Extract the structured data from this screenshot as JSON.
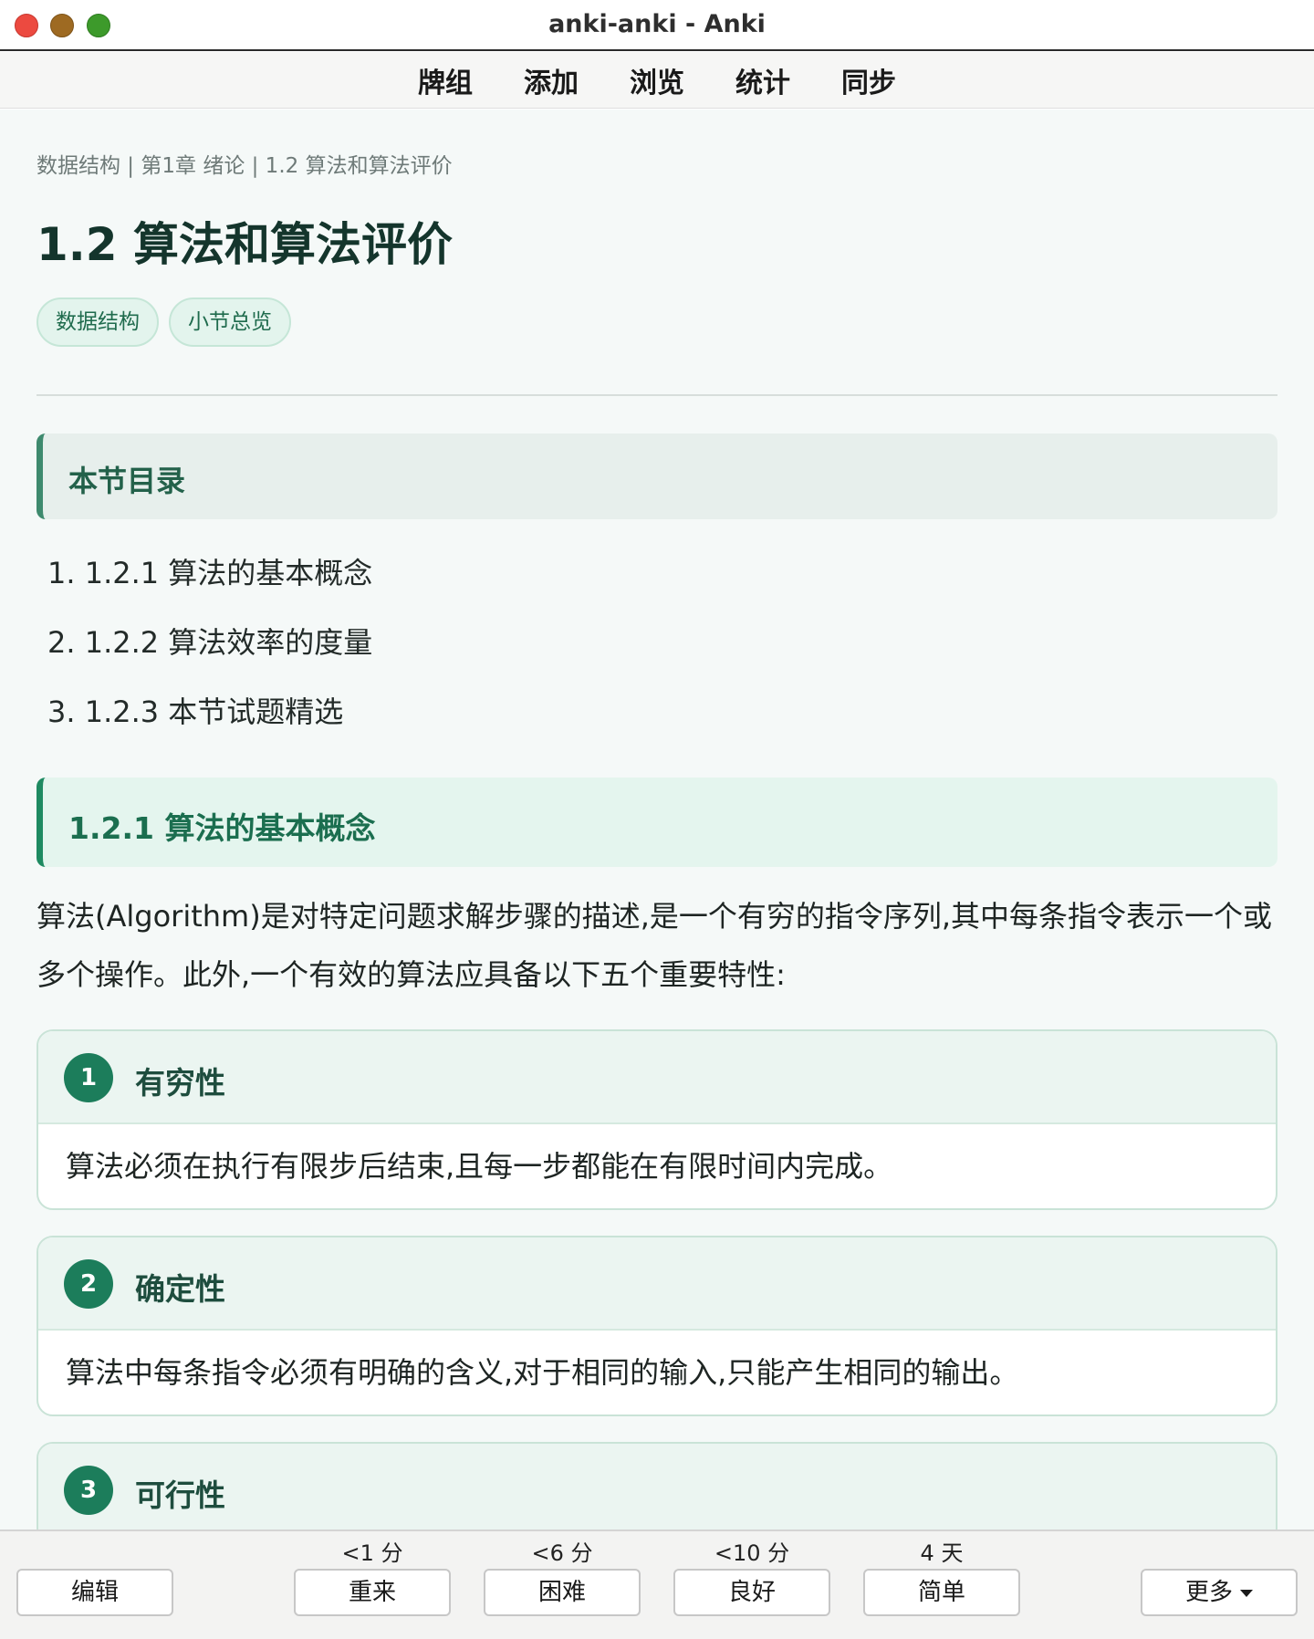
{
  "window": {
    "title": "anki-anki - Anki"
  },
  "toolbar": {
    "items": [
      "牌组",
      "添加",
      "浏览",
      "统计",
      "同步"
    ]
  },
  "card": {
    "breadcrumb": "数据结构 | 第1章 绪论 | 1.2 算法和算法评价",
    "title": "1.2 算法和算法评价",
    "tags": [
      "数据结构",
      "小节总览"
    ],
    "toc": {
      "heading": "本节目录",
      "items": [
        "1. 1.2.1 算法的基本概念",
        "2. 1.2.2 算法效率的度量",
        "3. 1.2.3 本节试题精选"
      ]
    },
    "section": {
      "heading": "1.2.1 算法的基本概念",
      "paragraph": "算法(Algorithm)是对特定问题求解步骤的描述,是一个有穷的指令序列,其中每条指令表示一个或多个操作。此外,一个有效的算法应具备以下五个重要特性:",
      "properties": [
        {
          "num": "1",
          "title": "有穷性",
          "body": "算法必须在执行有限步后结束,且每一步都能在有限时间内完成。"
        },
        {
          "num": "2",
          "title": "确定性",
          "body": "算法中每条指令必须有明确的含义,对于相同的输入,只能产生相同的输出。"
        },
        {
          "num": "3",
          "title": "可行性",
          "body": ""
        }
      ]
    }
  },
  "answer_bar": {
    "edit": "编辑",
    "buttons": [
      {
        "label": "重来",
        "time": "<1 分"
      },
      {
        "label": "困难",
        "time": "<6 分"
      },
      {
        "label": "良好",
        "time": "<10 分"
      },
      {
        "label": "简单",
        "time": "4 天"
      }
    ],
    "more": "更多"
  },
  "colors": {
    "accent": "#1c7d5b",
    "content_bg": "#f5f9f8",
    "toc_border": "#3e8a6e"
  }
}
